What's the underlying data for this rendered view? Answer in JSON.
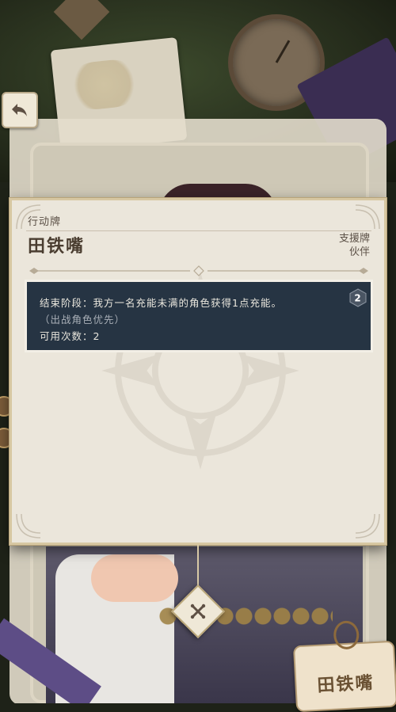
{
  "card": {
    "type_label": "行动牌",
    "title": "田铁嘴",
    "tags": [
      "支援牌",
      "伙伴"
    ],
    "effect": {
      "line1": "结束阶段：我方一名充能未满的角色获得1点充能。",
      "line2": "（出战角色优先）",
      "usage_label": "可用次数：",
      "usage_count": "2"
    },
    "cost": "2"
  },
  "name_tag": {
    "label": "田铁嘴"
  },
  "colors": {
    "panel_bg": "#ebe6db",
    "effect_bg": "#263443",
    "title_text": "#4a3d30"
  }
}
